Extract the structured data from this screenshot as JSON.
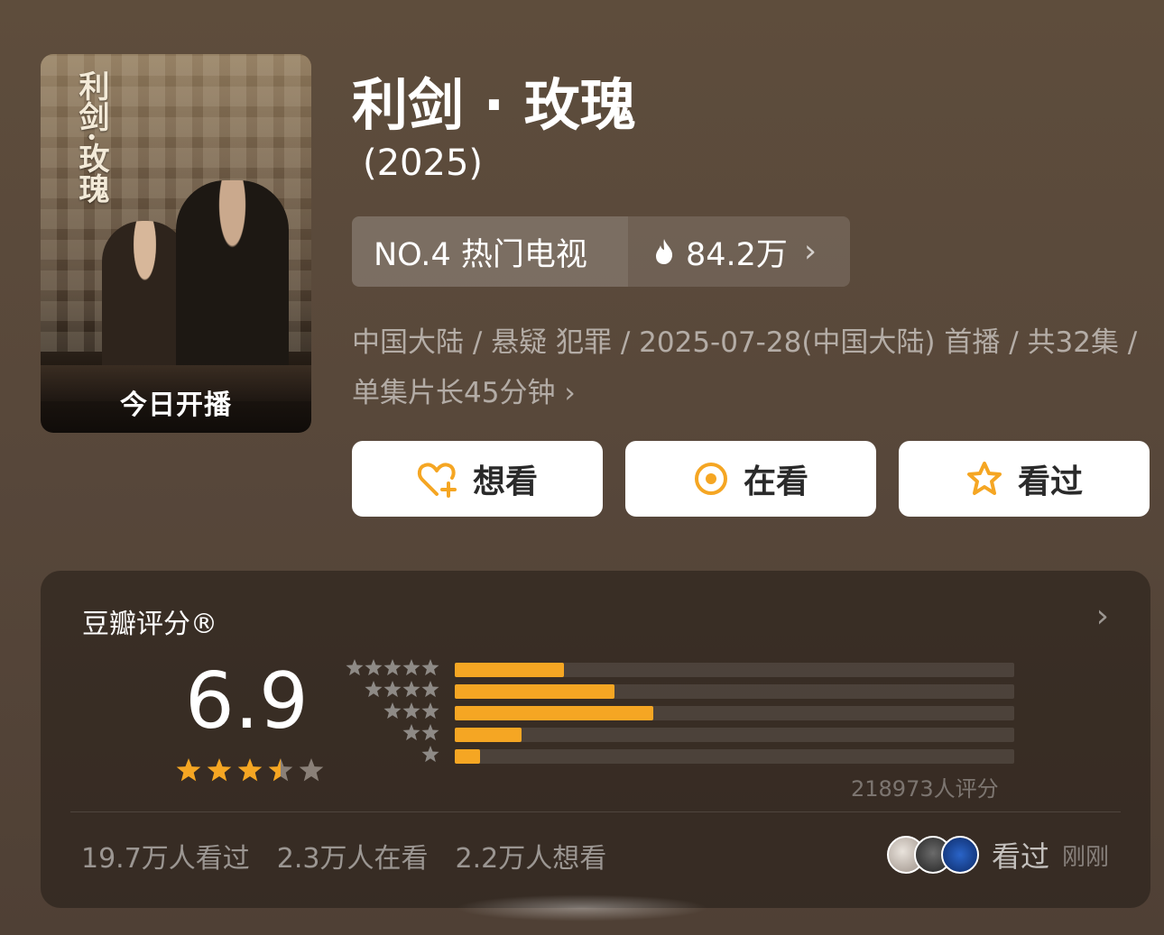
{
  "poster": {
    "title_vertical": "利剑·玫瑰",
    "badge": "今日开播"
  },
  "title": "利剑 · 玫瑰",
  "year": "(2025)",
  "rank": {
    "label": "NO.4 热门电视",
    "heat": "84.2万",
    "heat_icon": "fire-icon"
  },
  "meta": "中国大陆 / 悬疑 犯罪 / 2025-07-28(中国大陆) 首播 / 共32集 / 单集片长45分钟",
  "actions": [
    {
      "label": "想看",
      "icon": "heart-plus-icon"
    },
    {
      "label": "在看",
      "icon": "target-icon"
    },
    {
      "label": "看过",
      "icon": "star-outline-icon"
    }
  ],
  "rating": {
    "title": "豆瓣评分®",
    "score": "6.9",
    "stars": 3.5,
    "distribution": [
      {
        "stars": 5,
        "percent": 19.5
      },
      {
        "stars": 4,
        "percent": 28.5
      },
      {
        "stars": 3,
        "percent": 35.5
      },
      {
        "stars": 2,
        "percent": 12
      },
      {
        "stars": 1,
        "percent": 4.5
      }
    ],
    "count": "218973人评分",
    "stats": [
      "19.7万人看过",
      "2.3万人在看",
      "2.2万人想看"
    ],
    "friends_action": "看过",
    "friends_time": "刚刚"
  },
  "colors": {
    "accent": "#f5a623",
    "background": "#5a4a3b"
  }
}
